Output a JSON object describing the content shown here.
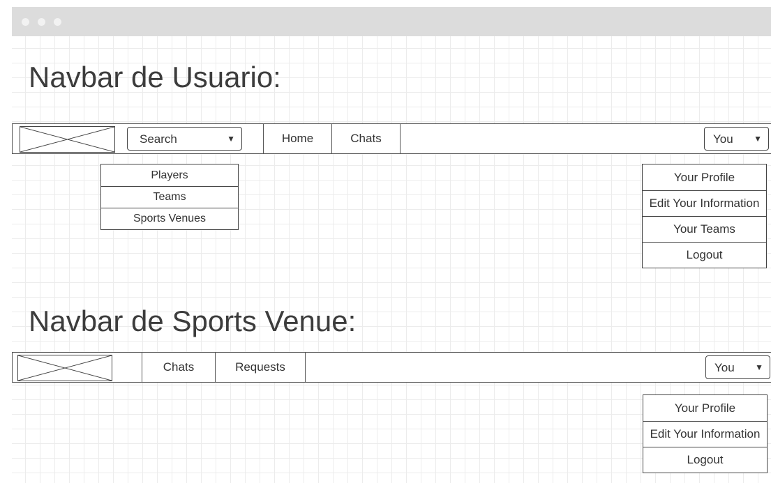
{
  "titlebar": {
    "dot_color": "#f2f2f2",
    "bar_color": "#dcdcdc"
  },
  "user_section": {
    "heading": "Navbar de Usuario:",
    "navbar": {
      "search_label": "Search",
      "nav_items": [
        "Home",
        "Chats"
      ],
      "you_label": "You"
    },
    "search_menu": [
      "Players",
      "Teams",
      "Sports Venues"
    ],
    "you_menu": [
      "Your Profile",
      "Edit Your Information",
      "Your Teams",
      "Logout"
    ]
  },
  "venue_section": {
    "heading": "Navbar de Sports Venue:",
    "navbar": {
      "nav_items": [
        "Chats",
        "Requests"
      ],
      "you_label": "You"
    },
    "you_menu": [
      "Your Profile",
      "Edit Your Information",
      "Logout"
    ]
  }
}
